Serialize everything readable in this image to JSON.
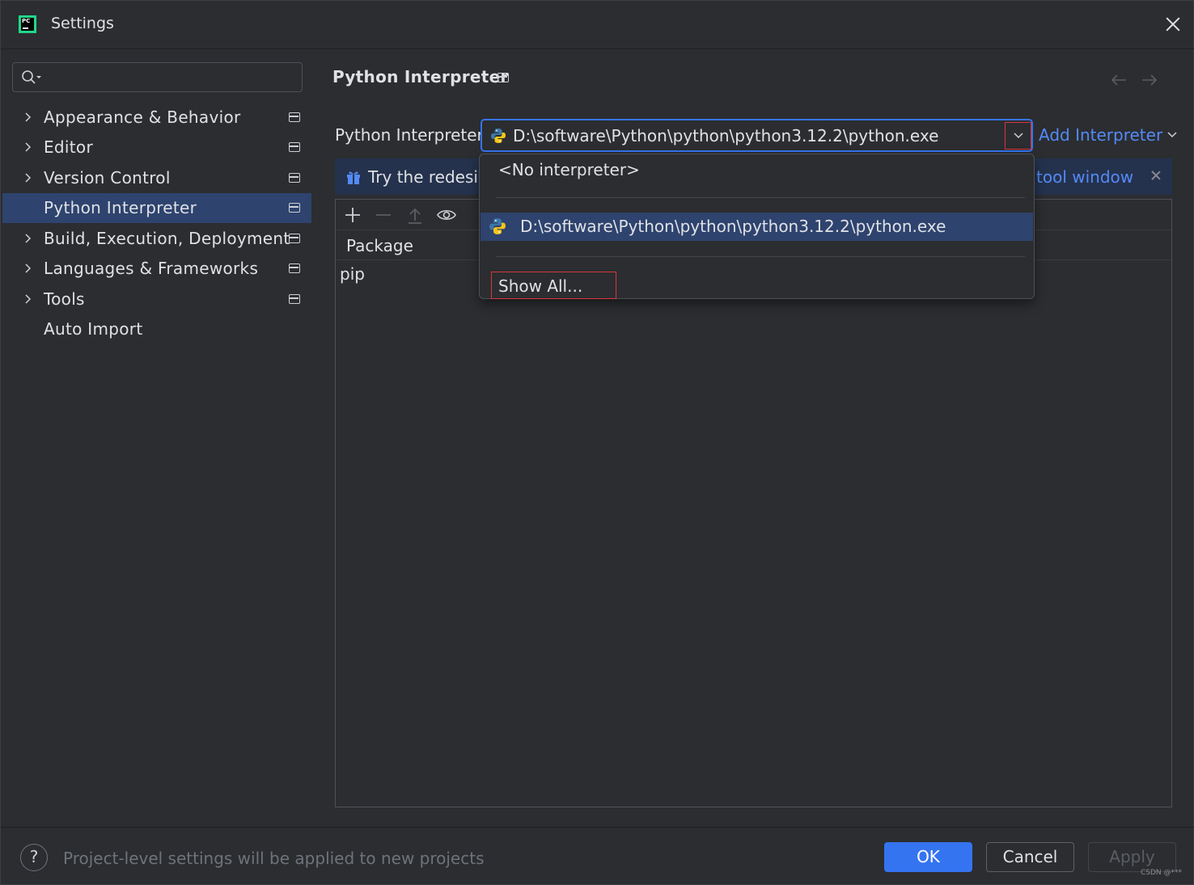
{
  "window": {
    "title": "Settings",
    "logo_text": "PC"
  },
  "sidebar": {
    "search": {
      "value": "",
      "placeholder": ""
    },
    "items": [
      {
        "label": "Appearance & Behavior",
        "expandable": true,
        "project_level": true,
        "selected": false
      },
      {
        "label": "Editor",
        "expandable": true,
        "project_level": true,
        "selected": false
      },
      {
        "label": "Version Control",
        "expandable": true,
        "project_level": true,
        "selected": false
      },
      {
        "label": "Python Interpreter",
        "expandable": false,
        "project_level": true,
        "selected": true
      },
      {
        "label": "Build, Execution, Deployment",
        "expandable": true,
        "project_level": true,
        "selected": false
      },
      {
        "label": "Languages & Frameworks",
        "expandable": true,
        "project_level": true,
        "selected": false
      },
      {
        "label": "Tools",
        "expandable": true,
        "project_level": true,
        "selected": false
      },
      {
        "label": "Auto Import",
        "expandable": false,
        "project_level": false,
        "selected": false
      }
    ]
  },
  "main": {
    "title": "Python Interpreter",
    "interpreter_label": "Python Interpreter:",
    "interpreter_value": "D:\\software\\Python\\python\\python3.12.2\\python.exe",
    "add_interpreter": "Add Interpreter",
    "banner": {
      "text": "Try the redesig",
      "link": "tool window"
    },
    "toolbar": {
      "add": "plus-icon",
      "remove": "minus-icon",
      "upgrade": "upload-icon",
      "show": "eye-icon"
    },
    "table": {
      "columns": [
        "Package"
      ],
      "rows": [
        [
          "pip"
        ]
      ]
    }
  },
  "dropdown": {
    "no_interpreter": "<No interpreter>",
    "options": [
      "D:\\software\\Python\\python\\python3.12.2\\python.exe"
    ],
    "show_all": "Show All..."
  },
  "footer": {
    "note": "Project-level settings will be applied to new projects",
    "help": "?",
    "ok": "OK",
    "cancel": "Cancel",
    "apply": "Apply"
  },
  "watermark": "CSDN @***",
  "colors": {
    "accent": "#3574f0",
    "selection": "#2e436e",
    "link": "#548af7",
    "highlight_border": "#d9363e"
  }
}
